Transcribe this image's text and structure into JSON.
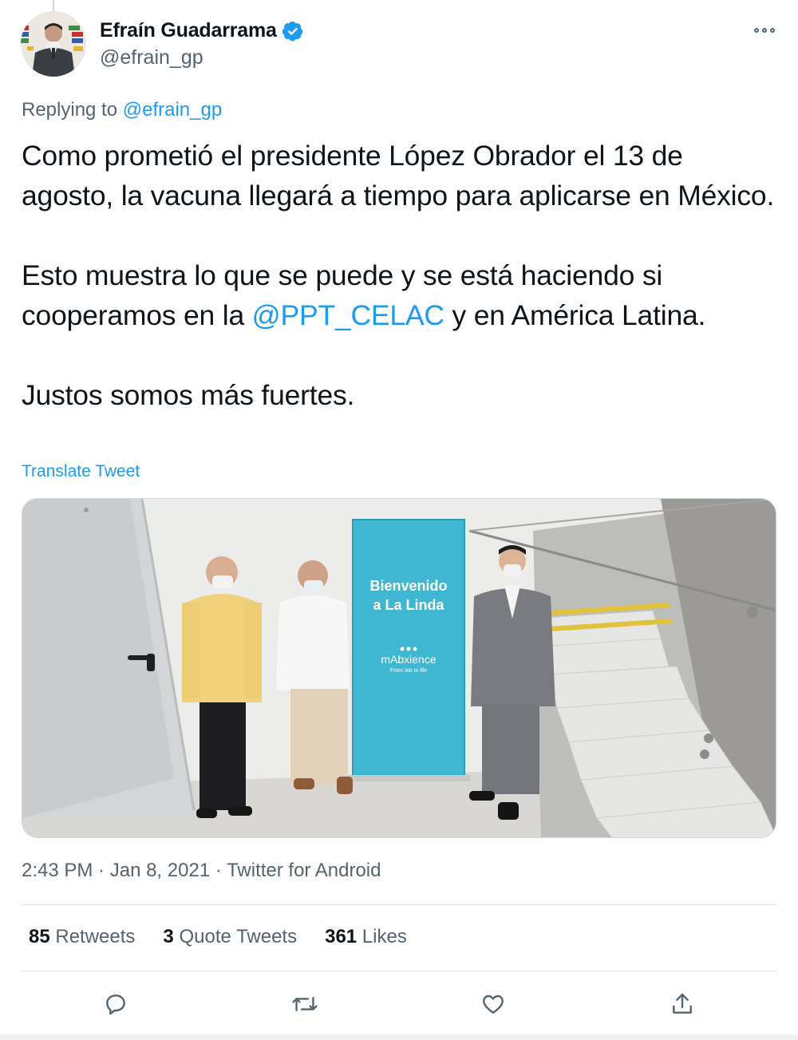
{
  "author": {
    "display_name": "Efraín Guadarrama",
    "handle": "@efrain_gp",
    "verified": true,
    "avatar_icon": "profile-photo"
  },
  "reply": {
    "prefix": "Replying to ",
    "mention": "@efrain_gp"
  },
  "tweet": {
    "p1": "Como prometió el presidente López Obrador el 13 de agosto, la vacuna llegará a tiempo para aplicarse en México.",
    "p2_before": "Esto muestra lo que se puede y se está haciendo si cooperamos en la ",
    "p2_mention": "@PPT_CELAC",
    "p2_after": " y en América Latina.",
    "p3": "Justos somos más fuertes."
  },
  "translate_label": "Translate Tweet",
  "media": {
    "banner_line1": "Bienvenido",
    "banner_line2": "a La Linda",
    "banner_brand": "mAbxience",
    "banner_tagline": "From lab to life"
  },
  "meta": {
    "time": "2:43 PM",
    "sep1": " · ",
    "date": "Jan 8, 2021",
    "sep2": " · ",
    "source": "Twitter for Android"
  },
  "stats": {
    "retweets_count": "85",
    "retweets_label": " Retweets",
    "quotes_count": "3",
    "quotes_label": " Quote Tweets",
    "likes_count": "361",
    "likes_label": " Likes"
  },
  "actions": [
    "reply-icon",
    "retweet-icon",
    "like-icon",
    "share-icon"
  ],
  "colors": {
    "accent": "#1d9bf0",
    "text": "#0f1419",
    "secondary": "#536471",
    "banner": "#3fb6d2"
  }
}
